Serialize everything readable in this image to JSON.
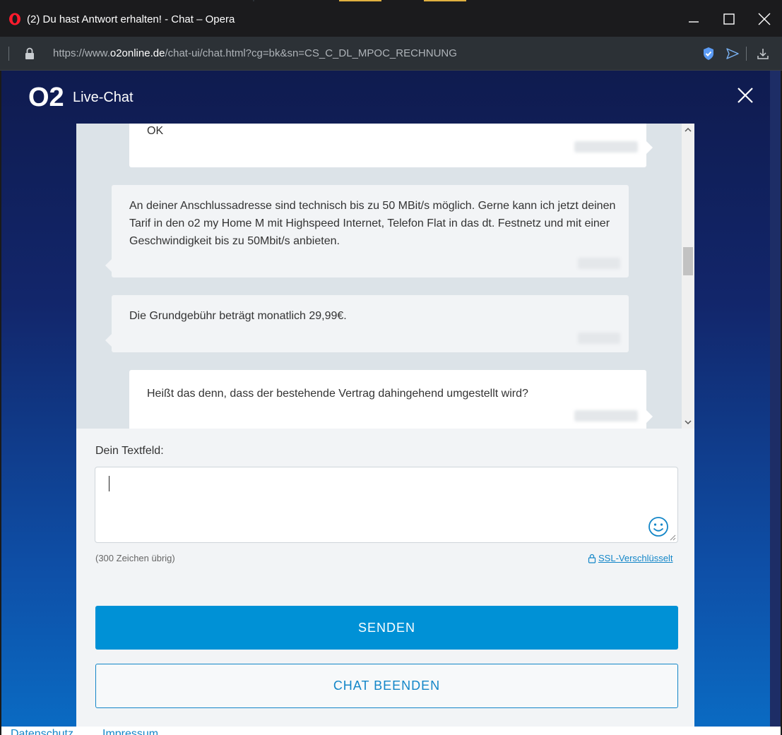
{
  "window": {
    "title": "(2) Du hast Antwort erhalten! - Chat – Opera",
    "controls": [
      "minimize-icon",
      "maximize-icon",
      "close-icon"
    ]
  },
  "address_bar": {
    "url_prefix": "https://www.",
    "url_domain": "o2online.de",
    "url_path": "/chat-ui/chat.html?cg=bk&sn=CS_C_DL_MPOC_RECHNUNG"
  },
  "header": {
    "logo_text": "O2",
    "title": "Live-Chat"
  },
  "messages": [
    {
      "sender": "user",
      "text": "OK"
    },
    {
      "sender": "agent",
      "text": "An deiner Anschlussadresse sind technisch bis zu 50 MBit/s möglich. Gerne kann ich jetzt deinen Tarif in den o2 my Home M mit Highspeed Internet, Telefon Flat in das dt. Festnetz und mit einer Geschwindigkeit bis zu 50Mbit/s anbieten."
    },
    {
      "sender": "agent",
      "text": "Die Grundgebühr beträgt monatlich 29,99€."
    },
    {
      "sender": "user",
      "text": "Heißt das denn, dass der bestehende Vertrag dahingehend umgestellt wird?"
    }
  ],
  "form": {
    "label": "Dein Textfeld:",
    "value": "",
    "chars_left": "(300 Zeichen übrig)",
    "ssl_label": "SSL-Verschlüsselt",
    "send_label": "SENDEN",
    "end_label": "CHAT BEENDEN"
  },
  "footer": {
    "links": [
      "Datenschutz",
      "Impressum"
    ]
  },
  "colors": {
    "accent": "#0091d6",
    "link": "#1386c8",
    "chat_bg": "#dce3e8"
  }
}
